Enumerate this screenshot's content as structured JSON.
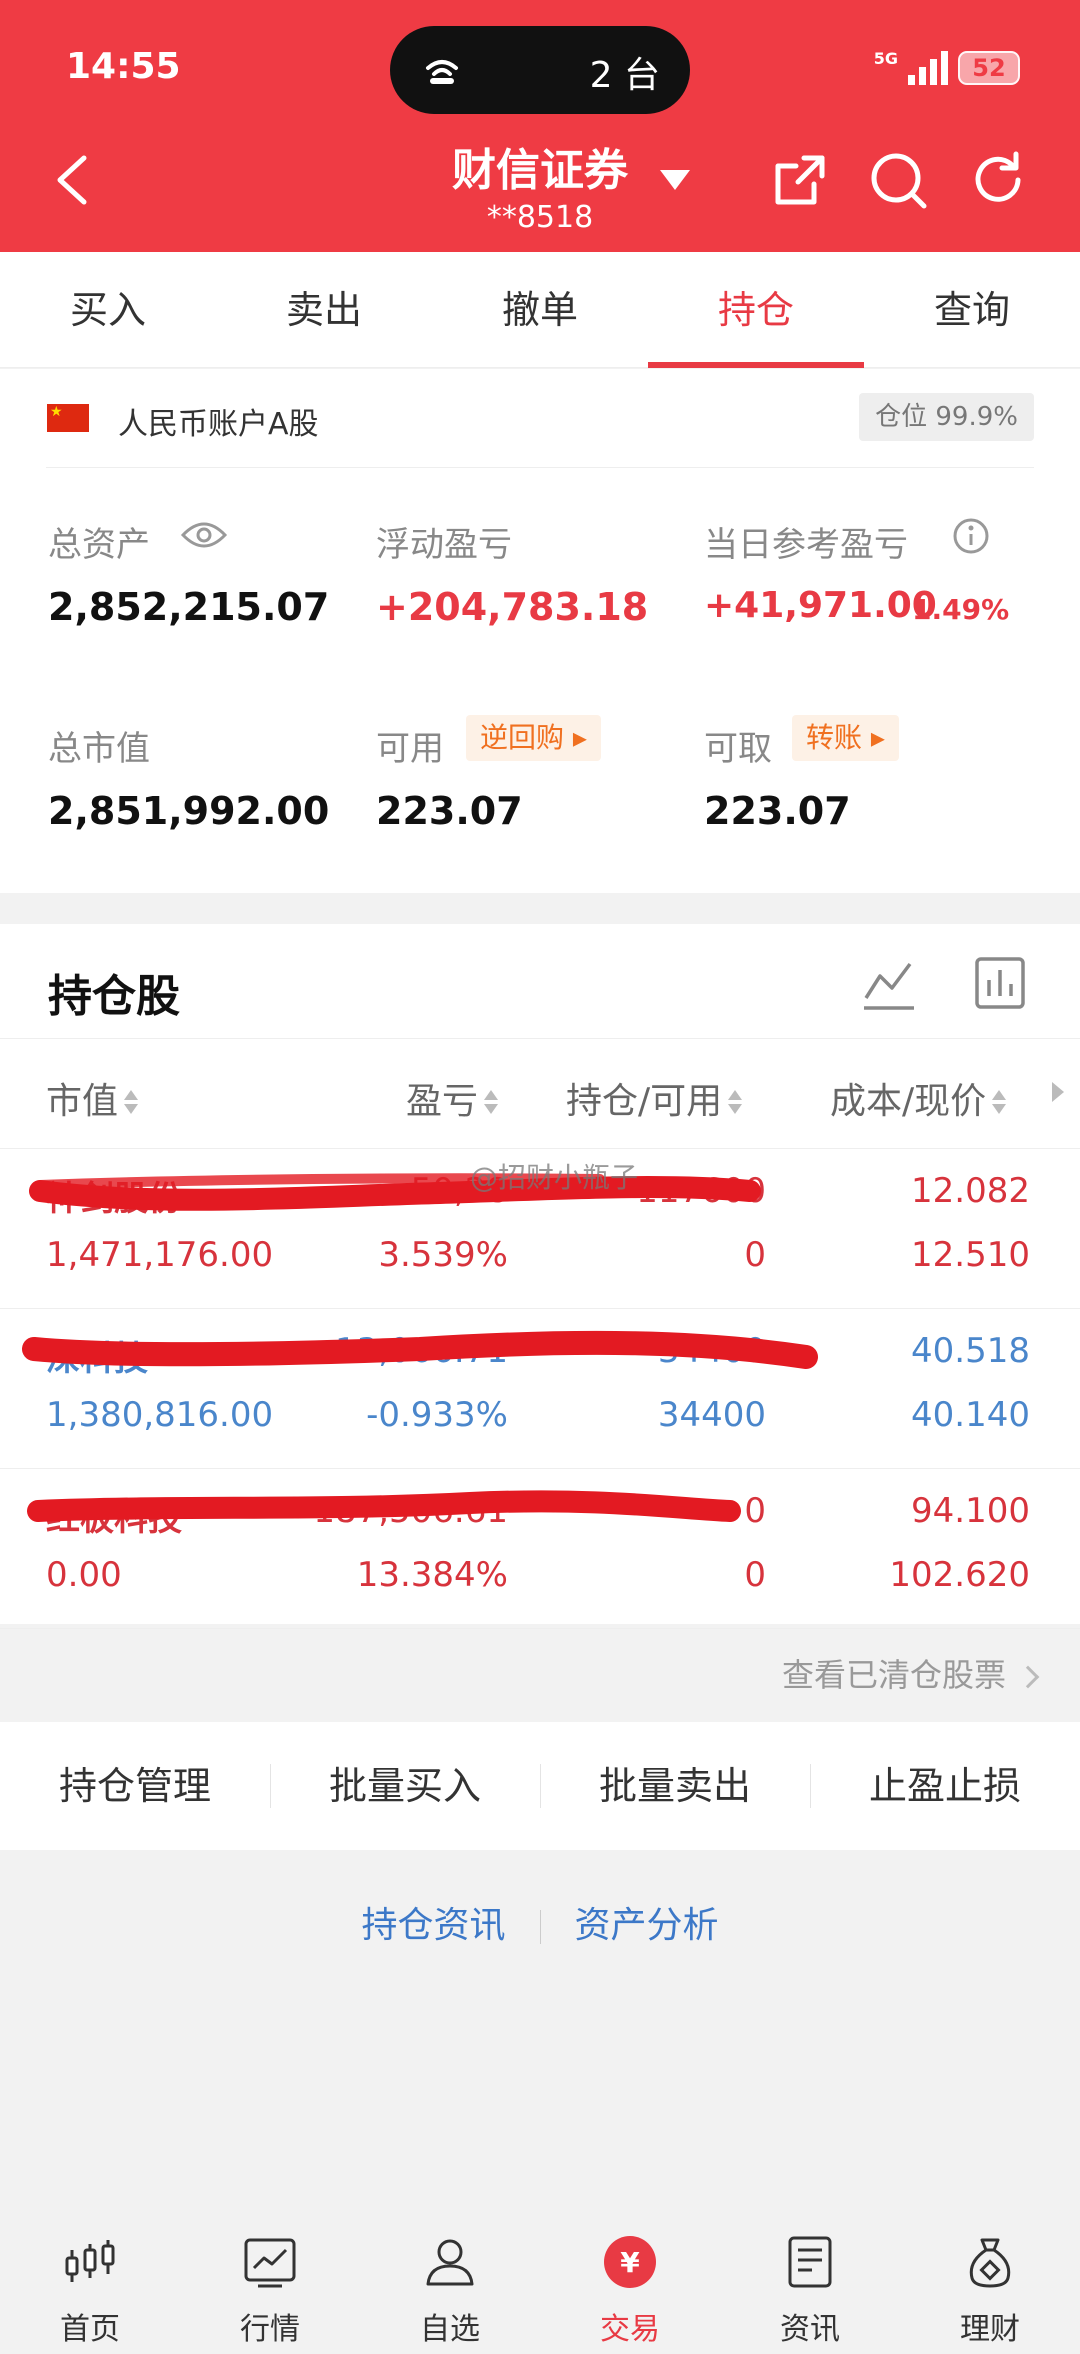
{
  "status_bar": {
    "time": "14:55",
    "pill_text": "2 台",
    "network": "5G",
    "battery": "52"
  },
  "header": {
    "title": "财信证券",
    "account": "**8518"
  },
  "tabs": [
    {
      "label": "买入"
    },
    {
      "label": "卖出"
    },
    {
      "label": "撤单"
    },
    {
      "label": "持仓",
      "active": true
    },
    {
      "label": "查询"
    }
  ],
  "account_summary": {
    "account_label": "人民币账户A股",
    "position_badge": "仓位 99.9%",
    "total_assets": {
      "label": "总资产",
      "value": "2,852,215.07"
    },
    "floating_pl": {
      "label": "浮动盈亏",
      "value": "+204,783.18"
    },
    "daily_ref_pl": {
      "label": "当日参考盈亏",
      "value": "+41,971.00",
      "percent": "1.49%"
    },
    "market_value": {
      "label": "总市值",
      "value": "2,851,992.00"
    },
    "available": {
      "label": "可用",
      "chip": "逆回购",
      "value": "223.07"
    },
    "withdrawable": {
      "label": "可取",
      "chip": "转账",
      "value": "223.07"
    }
  },
  "holdings": {
    "title": "持仓股",
    "columns": {
      "market_value": "市值",
      "pl": "盈亏",
      "position": "持仓/可用",
      "cost_price": "成本/现价"
    },
    "watermark": "@招财小瓶子",
    "rows": [
      {
        "name": "神剑股份",
        "pl": "50,28",
        "position": "117600",
        "cost": "12.082",
        "market_value": "1,471,176.00",
        "pl_pct": "3.539%",
        "available": "0",
        "price": "12.510"
      },
      {
        "name": "深科技",
        "pl": "13,066.71",
        "position": "34400",
        "cost": "40.518",
        "market_value": "1,380,816.00",
        "pl_pct": "-0.933%",
        "available": "34400",
        "price": "40.140"
      },
      {
        "name": "红板科技",
        "pl": "187,506.61",
        "position": "0",
        "cost": "94.100",
        "market_value": "0.00",
        "pl_pct": "13.384%",
        "available": "0",
        "price": "102.620"
      }
    ]
  },
  "cleared_link": "查看已清仓股票",
  "actions": [
    {
      "label": "持仓管理"
    },
    {
      "label": "批量买入"
    },
    {
      "label": "批量卖出"
    },
    {
      "label": "止盈止损"
    }
  ],
  "links": {
    "news": "持仓资讯",
    "analysis": "资产分析"
  },
  "bottom_nav": [
    {
      "label": "首页",
      "icon": "candlestick-icon"
    },
    {
      "label": "行情",
      "icon": "market-chart-icon"
    },
    {
      "label": "自选",
      "icon": "person-icon"
    },
    {
      "label": "交易",
      "icon": "yuan-coin-icon",
      "active": true
    },
    {
      "label": "资讯",
      "icon": "news-document-icon"
    },
    {
      "label": "理财",
      "icon": "money-bag-icon"
    }
  ],
  "colors": {
    "brand_red": "#ef3b44",
    "profit_red": "#d7333c",
    "loss_blue": "#4a86cb",
    "chip_orange": "#f07020"
  }
}
